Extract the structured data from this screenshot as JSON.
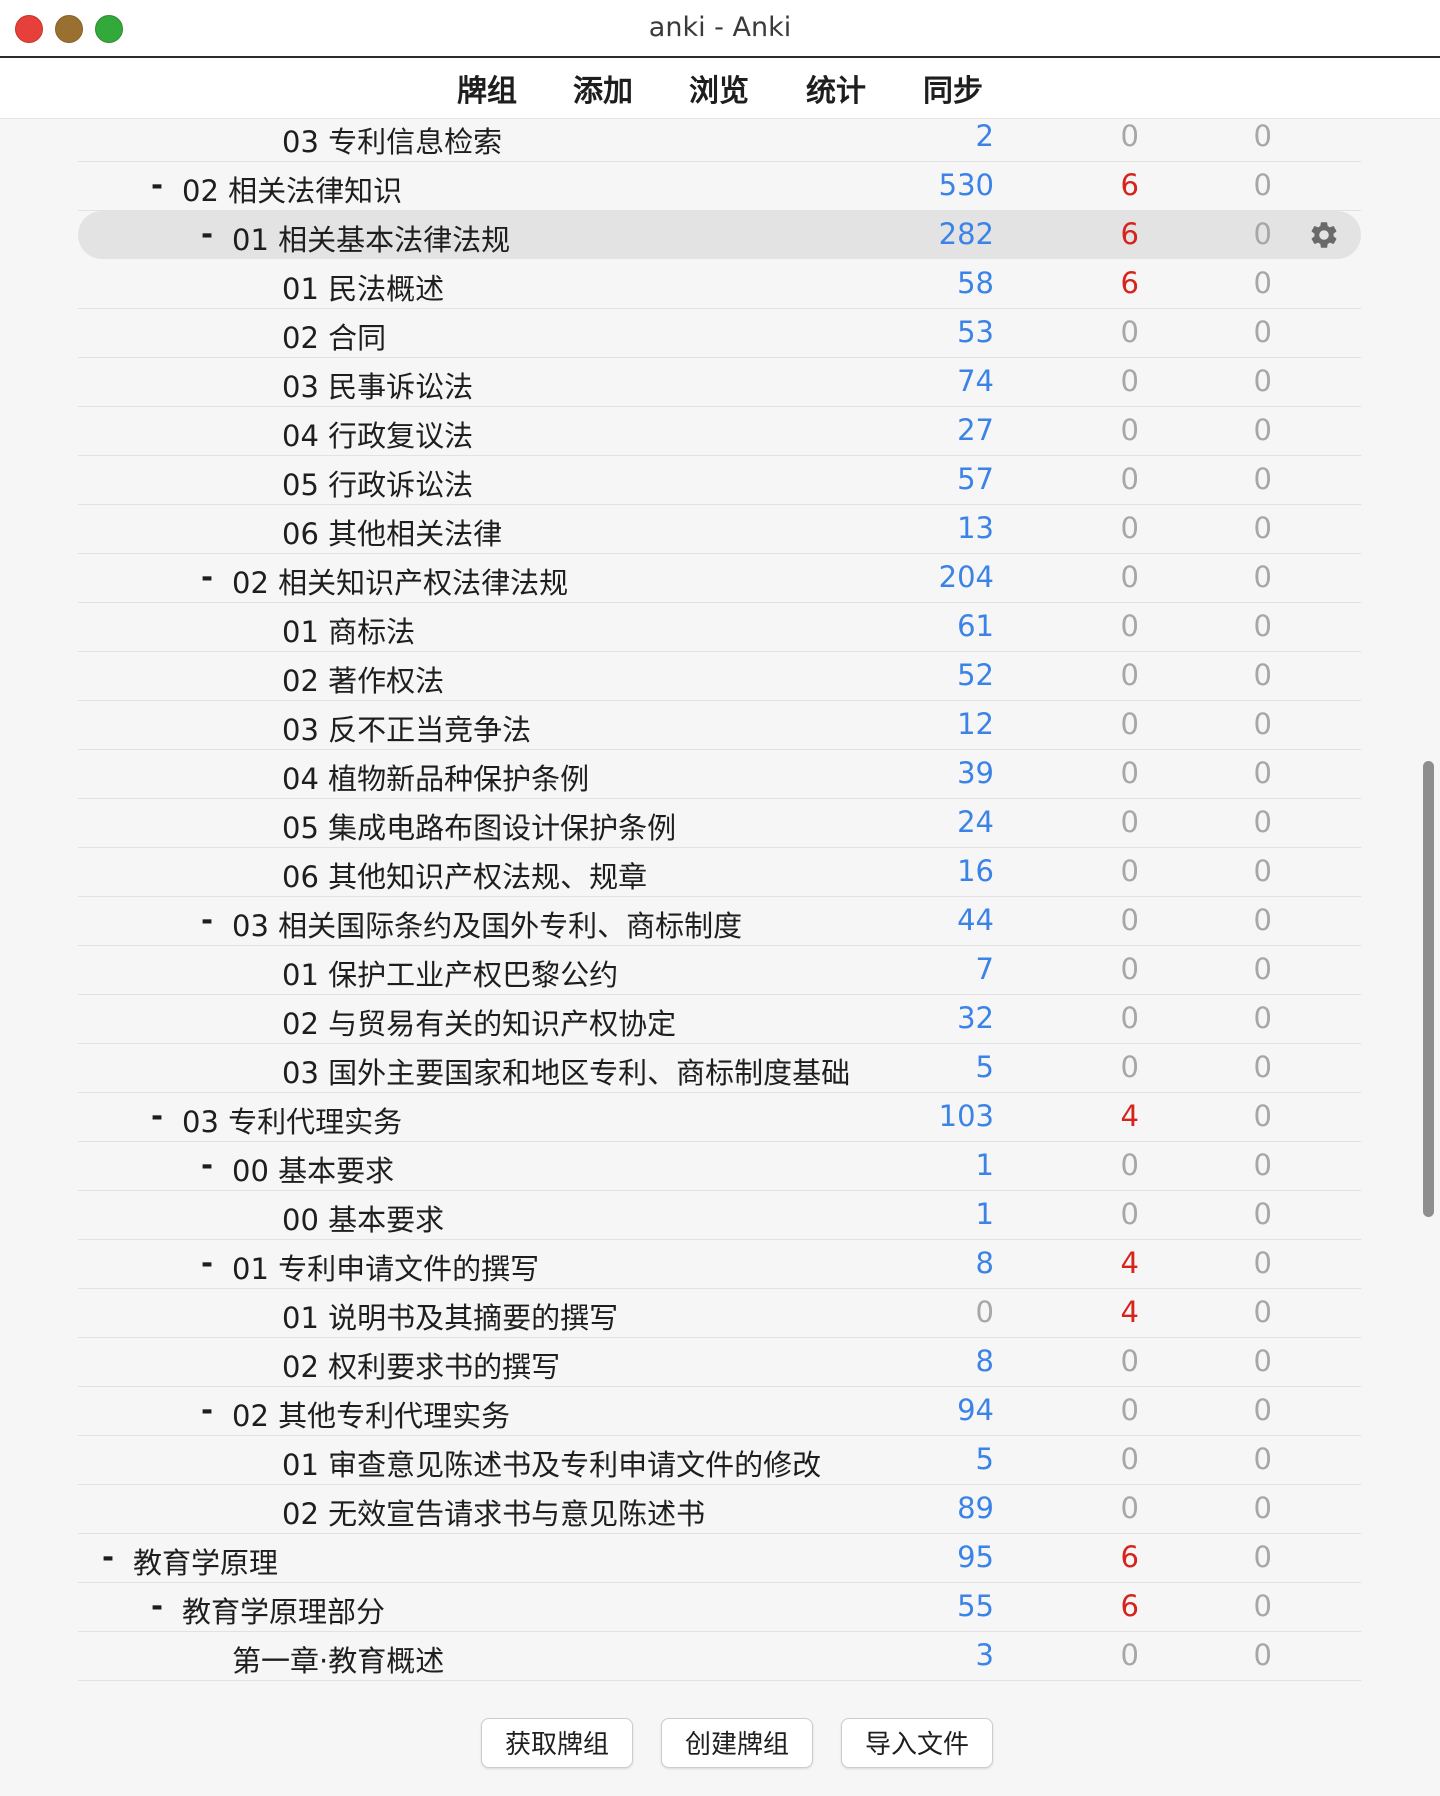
{
  "window": {
    "title": "anki - Anki"
  },
  "toolbar": {
    "decks": "牌组",
    "add": "添加",
    "browse": "浏览",
    "stats": "统计",
    "sync": "同步"
  },
  "colors": {
    "new": "#3c83e8",
    "learn": "#d6231c",
    "zero": "#a7a7a7",
    "current_row": "#e3e3e3"
  },
  "deck_rows": [
    {
      "name": "03 专利信息检索",
      "depth": 3,
      "collapse": "",
      "new": 2,
      "learn": 0,
      "due": 0
    },
    {
      "name": "02 相关法律知识",
      "depth": 1,
      "collapse": "-",
      "new": 530,
      "learn": 6,
      "due": 0
    },
    {
      "name": "01 相关基本法律法规",
      "depth": 2,
      "collapse": "-",
      "new": 282,
      "learn": 6,
      "due": 0,
      "current": true
    },
    {
      "name": "01 民法概述",
      "depth": 3,
      "collapse": "",
      "new": 58,
      "learn": 6,
      "due": 0
    },
    {
      "name": "02 合同",
      "depth": 3,
      "collapse": "",
      "new": 53,
      "learn": 0,
      "due": 0
    },
    {
      "name": "03 民事诉讼法",
      "depth": 3,
      "collapse": "",
      "new": 74,
      "learn": 0,
      "due": 0
    },
    {
      "name": "04 行政复议法",
      "depth": 3,
      "collapse": "",
      "new": 27,
      "learn": 0,
      "due": 0
    },
    {
      "name": "05 行政诉讼法",
      "depth": 3,
      "collapse": "",
      "new": 57,
      "learn": 0,
      "due": 0
    },
    {
      "name": "06 其他相关法律",
      "depth": 3,
      "collapse": "",
      "new": 13,
      "learn": 0,
      "due": 0
    },
    {
      "name": "02 相关知识产权法律法规",
      "depth": 2,
      "collapse": "-",
      "new": 204,
      "learn": 0,
      "due": 0
    },
    {
      "name": "01 商标法",
      "depth": 3,
      "collapse": "",
      "new": 61,
      "learn": 0,
      "due": 0
    },
    {
      "name": "02 著作权法",
      "depth": 3,
      "collapse": "",
      "new": 52,
      "learn": 0,
      "due": 0
    },
    {
      "name": "03 反不正当竞争法",
      "depth": 3,
      "collapse": "",
      "new": 12,
      "learn": 0,
      "due": 0
    },
    {
      "name": "04 植物新品种保护条例",
      "depth": 3,
      "collapse": "",
      "new": 39,
      "learn": 0,
      "due": 0
    },
    {
      "name": "05 集成电路布图设计保护条例",
      "depth": 3,
      "collapse": "",
      "new": 24,
      "learn": 0,
      "due": 0
    },
    {
      "name": "06 其他知识产权法规、规章",
      "depth": 3,
      "collapse": "",
      "new": 16,
      "learn": 0,
      "due": 0
    },
    {
      "name": "03 相关国际条约及国外专利、商标制度",
      "depth": 2,
      "collapse": "-",
      "new": 44,
      "learn": 0,
      "due": 0
    },
    {
      "name": "01 保护工业产权巴黎公约",
      "depth": 3,
      "collapse": "",
      "new": 7,
      "learn": 0,
      "due": 0
    },
    {
      "name": "02 与贸易有关的知识产权协定",
      "depth": 3,
      "collapse": "",
      "new": 32,
      "learn": 0,
      "due": 0
    },
    {
      "name": "03 国外主要国家和地区专利、商标制度基础",
      "depth": 3,
      "collapse": "",
      "new": 5,
      "learn": 0,
      "due": 0
    },
    {
      "name": "03 专利代理实务",
      "depth": 1,
      "collapse": "-",
      "new": 103,
      "learn": 4,
      "due": 0
    },
    {
      "name": "00 基本要求",
      "depth": 2,
      "collapse": "-",
      "new": 1,
      "learn": 0,
      "due": 0
    },
    {
      "name": "00 基本要求",
      "depth": 3,
      "collapse": "",
      "new": 1,
      "learn": 0,
      "due": 0
    },
    {
      "name": "01 专利申请文件的撰写",
      "depth": 2,
      "collapse": "-",
      "new": 8,
      "learn": 4,
      "due": 0
    },
    {
      "name": "01 说明书及其摘要的撰写",
      "depth": 3,
      "collapse": "",
      "new": 0,
      "learn": 4,
      "due": 0
    },
    {
      "name": "02 权利要求书的撰写",
      "depth": 3,
      "collapse": "",
      "new": 8,
      "learn": 0,
      "due": 0
    },
    {
      "name": "02 其他专利代理实务",
      "depth": 2,
      "collapse": "-",
      "new": 94,
      "learn": 0,
      "due": 0
    },
    {
      "name": "01 审查意见陈述书及专利申请文件的修改",
      "depth": 3,
      "collapse": "",
      "new": 5,
      "learn": 0,
      "due": 0
    },
    {
      "name": "02 无效宣告请求书与意见陈述书",
      "depth": 3,
      "collapse": "",
      "new": 89,
      "learn": 0,
      "due": 0
    },
    {
      "name": "教育学原理",
      "depth": 0,
      "collapse": "-",
      "new": 95,
      "learn": 6,
      "due": 0
    },
    {
      "name": "教育学原理部分",
      "depth": 1,
      "collapse": "-",
      "new": 55,
      "learn": 6,
      "due": 0
    },
    {
      "name": "第一章·教育概述",
      "depth": 2,
      "collapse": "",
      "new": 3,
      "learn": 0,
      "due": 0
    }
  ],
  "bottom": {
    "get_shared": "获取牌组",
    "create_deck": "创建牌组",
    "import_file": "导入文件"
  },
  "icons": {
    "options": "gear-icon"
  }
}
